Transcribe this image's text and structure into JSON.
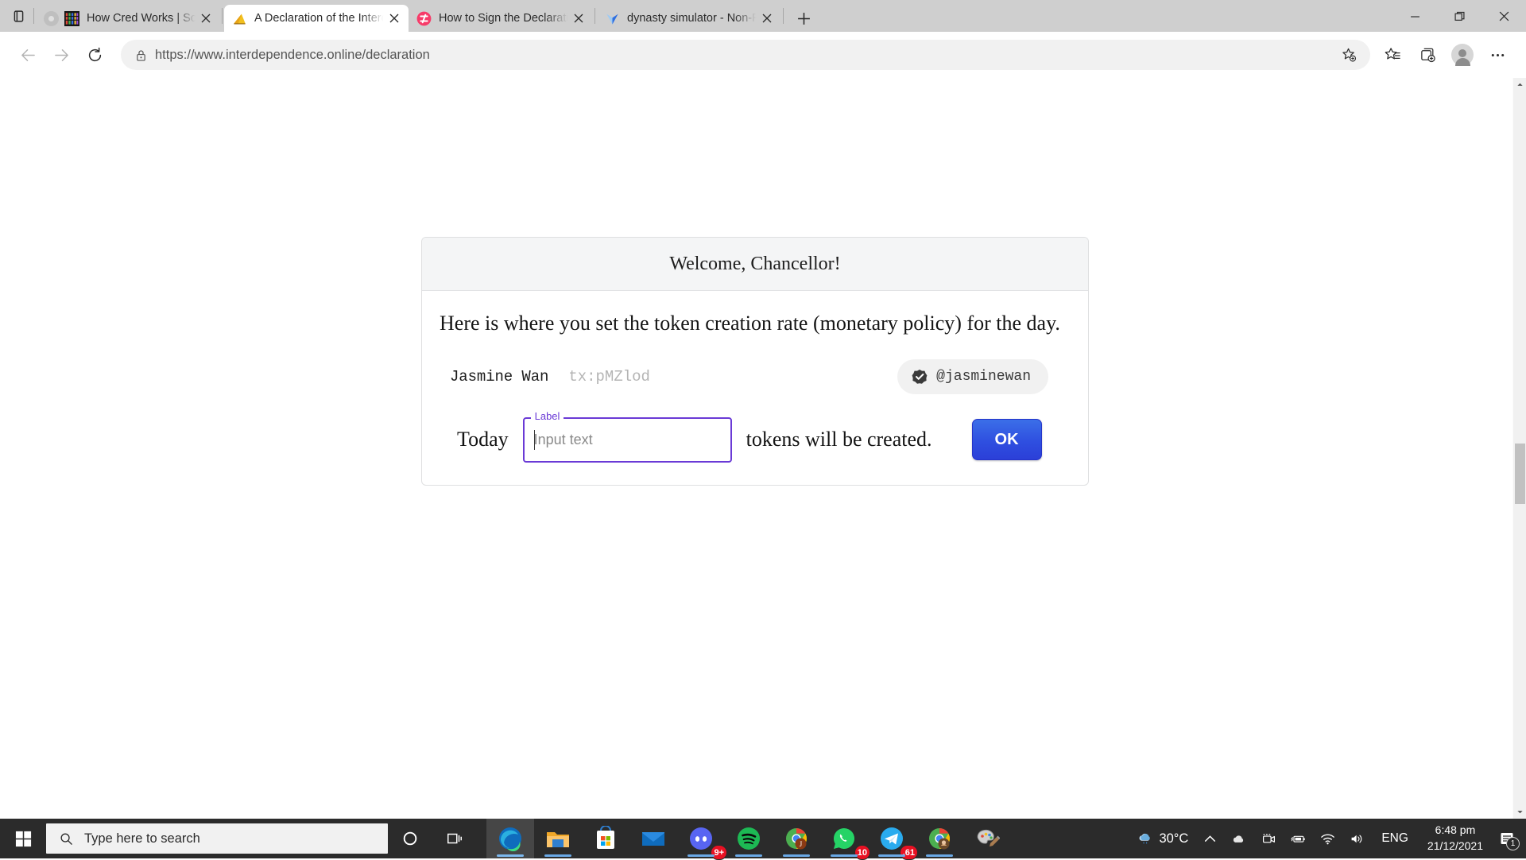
{
  "browser": {
    "tabs": [
      {
        "title": "How Cred Works | SourceCred",
        "favicon": "grid-favicon",
        "active": false,
        "has_mute_indicator": true,
        "close_label": "✕"
      },
      {
        "title": "A Declaration of the Interdependence",
        "favicon": "yellow-triangle-favicon",
        "active": true,
        "has_mute_indicator": false,
        "close_label": "✕"
      },
      {
        "title": "How to Sign the Declaration of In",
        "favicon": "pink-circle-favicon",
        "active": false,
        "has_mute_indicator": false,
        "close_label": "✕"
      },
      {
        "title": "dynasty simulator - Non-Fungible",
        "favicon": "blue-arrow-favicon",
        "active": false,
        "has_mute_indicator": false,
        "close_label": "✕"
      }
    ],
    "new_tab_label": "+",
    "window_controls": {
      "minimize": "—",
      "maximize": "❐",
      "close": "✕"
    },
    "toolbar": {
      "back_icon": "back-arrow-icon",
      "forward_icon": "forward-arrow-icon",
      "refresh_icon": "refresh-icon",
      "lock_icon": "lock-icon",
      "url_scheme": "https://www.",
      "url_host": "interdependence.online",
      "url_path": "/declaration",
      "url_full": "https://www.interdependence.online/declaration",
      "favorite_icon": "add-favorite-star-icon",
      "favorites_icon": "favorites-list-icon",
      "collections_icon": "collections-icon",
      "profile_icon": "profile-avatar-icon",
      "settings_icon": "more-options-icon"
    }
  },
  "page": {
    "modal": {
      "title": "Welcome, Chancellor!",
      "lead": "Here is where you set the token creation rate (monetary policy) for the day.",
      "user": {
        "name": "Jasmine Wan",
        "tx": "tx:pMZlod",
        "handle": "@jasminewan",
        "verified_icon": "verified-check-icon"
      },
      "policy": {
        "prefix": "Today",
        "suffix": "tokens will be created.",
        "field_label": "Label",
        "field_placeholder": "Input text",
        "field_value": "",
        "submit_label": "OK"
      },
      "accent_color": "#6a3ad6",
      "button_color": "#2f4fe0"
    },
    "scrollbar": {
      "up_arrow": "scroll-up-arrow",
      "down_arrow": "scroll-down-arrow"
    }
  },
  "taskbar": {
    "start_icon": "windows-start-icon",
    "search_placeholder": "Type here to search",
    "search_icon": "search-icon",
    "cortana_icon": "cortana-circle-icon",
    "taskview_icon": "task-view-icon",
    "apps": [
      {
        "name": "microsoft-edge",
        "badge": "",
        "focused": true,
        "running": true
      },
      {
        "name": "file-explorer",
        "badge": "",
        "focused": false,
        "running": true
      },
      {
        "name": "microsoft-store",
        "badge": "",
        "focused": false,
        "running": false
      },
      {
        "name": "mail",
        "badge": "",
        "focused": false,
        "running": false
      },
      {
        "name": "discord",
        "badge": "9+",
        "focused": false,
        "running": true
      },
      {
        "name": "spotify",
        "badge": "",
        "focused": false,
        "running": true
      },
      {
        "name": "chrome-profile-j",
        "badge": "",
        "focused": false,
        "running": true
      },
      {
        "name": "whatsapp",
        "badge": "10",
        "focused": false,
        "running": true
      },
      {
        "name": "telegram",
        "badge": ".61",
        "focused": false,
        "running": true
      },
      {
        "name": "chrome-profile-avatar",
        "badge": "",
        "focused": false,
        "running": true
      },
      {
        "name": "paint-3d",
        "badge": "",
        "focused": false,
        "running": false
      }
    ],
    "tray": {
      "weather_icon": "rain-cloud-icon",
      "temperature": "30°C",
      "chevron_icon": "show-hidden-icons-chevron",
      "onedrive_icon": "onedrive-cloud-icon",
      "meet_icon": "camera-icon",
      "battery_icon": "battery-charging-icon",
      "network_icon": "wifi-icon",
      "volume_icon": "speaker-icon",
      "language": "ENG",
      "time": "6:48 pm",
      "date": "21/12/2021",
      "notification_icon": "notifications-icon",
      "notification_count": "1"
    }
  }
}
